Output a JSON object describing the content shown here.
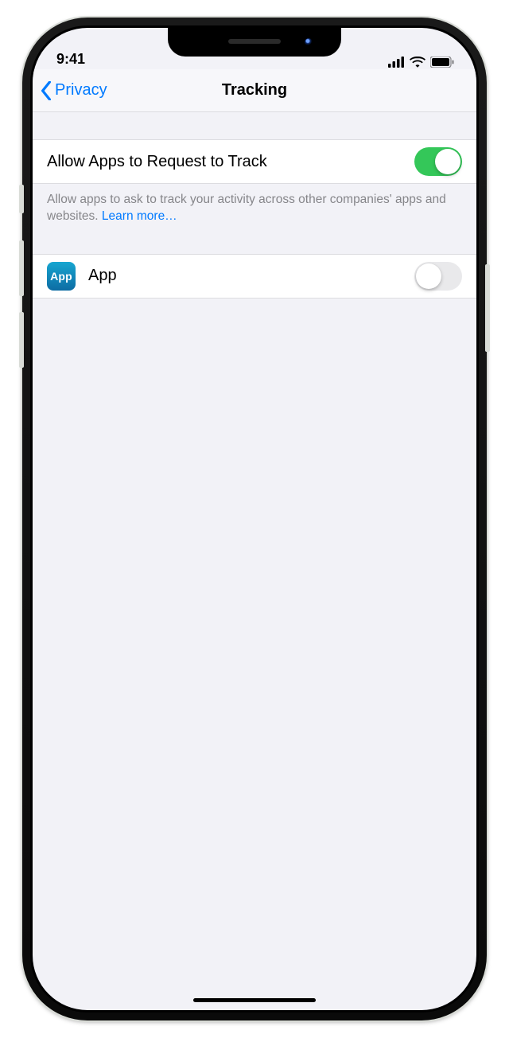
{
  "status": {
    "time": "9:41"
  },
  "nav": {
    "back": "Privacy",
    "title": "Tracking"
  },
  "allow": {
    "label": "Allow Apps to Request to Track",
    "on": true,
    "footer_pre": "Allow apps to ask to track your activity across other companies' apps and websites. ",
    "learn_more": "Learn more…"
  },
  "apps": [
    {
      "name": "App",
      "icon_text": "App",
      "on": false
    }
  ]
}
